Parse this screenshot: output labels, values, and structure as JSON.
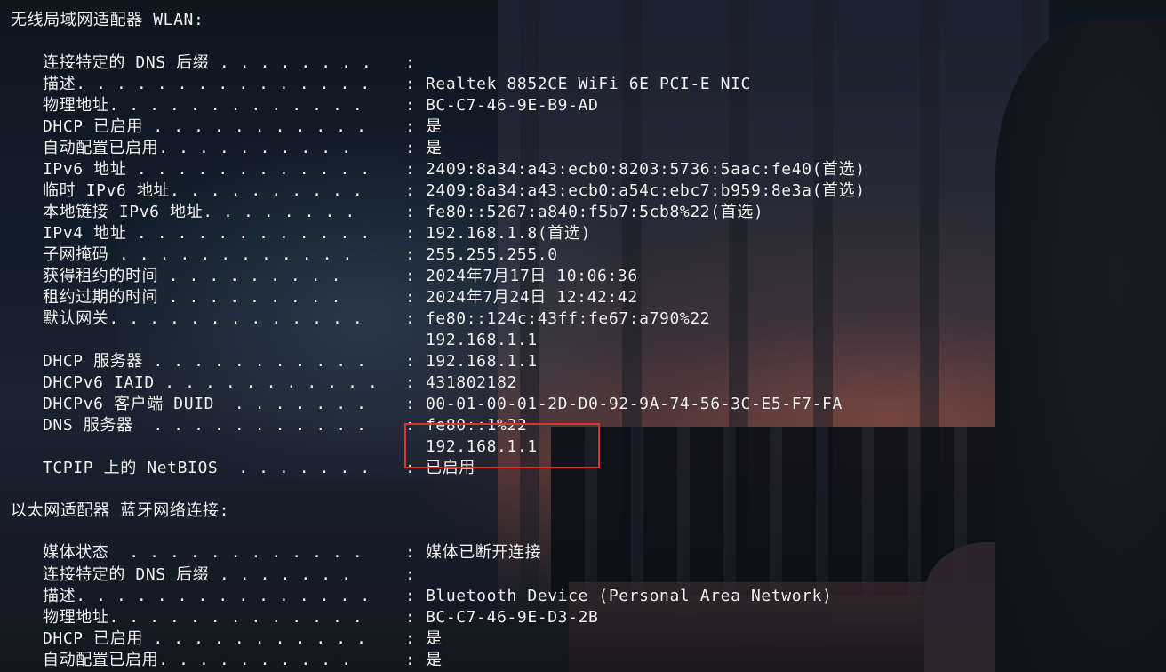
{
  "sections": [
    {
      "title": "无线局域网适配器 WLAN:",
      "entries": [
        {
          "label": "连接特定的 DNS 后缀 . . . . . . . .",
          "value": ""
        },
        {
          "label": "描述. . . . . . . . . . . . . . .",
          "value": "Realtek 8852CE WiFi 6E PCI-E NIC"
        },
        {
          "label": "物理地址. . . . . . . . . . . . .",
          "value": "BC-C7-46-9E-B9-AD"
        },
        {
          "label": "DHCP 已启用 . . . . . . . . . . .",
          "value": "是"
        },
        {
          "label": "自动配置已启用. . . . . . . . . .",
          "value": "是"
        },
        {
          "label": "IPv6 地址 . . . . . . . . . . . .",
          "value": "2409:8a34:a43:ecb0:8203:5736:5aac:fe40(首选)"
        },
        {
          "label": "临时 IPv6 地址. . . . . . . . . .",
          "value": "2409:8a34:a43:ecb0:a54c:ebc7:b959:8e3a(首选)"
        },
        {
          "label": "本地链接 IPv6 地址. . . . . . . .",
          "value": "fe80::5267:a840:f5b7:5cb8%22(首选)"
        },
        {
          "label": "IPv4 地址 . . . . . . . . . . . .",
          "value": "192.168.1.8(首选)"
        },
        {
          "label": "子网掩码 . . . . . . . . . . . .",
          "value": "255.255.255.0"
        },
        {
          "label": "获得租约的时间 . . . . . . . . .",
          "value": "2024年7月17日 10:06:36"
        },
        {
          "label": "租约过期的时间 . . . . . . . . .",
          "value": "2024年7月24日 12:42:42"
        },
        {
          "label": "默认网关. . . . . . . . . . . . .",
          "value": "fe80::124c:43ff:fe67:a790%22"
        },
        {
          "label": "",
          "value": "192.168.1.1"
        },
        {
          "label": "DHCP 服务器 . . . . . . . . . . .",
          "value": "192.168.1.1"
        },
        {
          "label": "DHCPv6 IAID . . . . . . . . . . .",
          "value": "431802182"
        },
        {
          "label": "DHCPv6 客户端 DUID  . . . . . . .",
          "value": "00-01-00-01-2D-D0-92-9A-74-56-3C-E5-F7-FA"
        },
        {
          "label": "DNS 服务器  . . . . . . . . . . .",
          "value": "fe80::1%22"
        },
        {
          "label": "",
          "value": "192.168.1.1"
        },
        {
          "label": "TCPIP 上的 NetBIOS  . . . . . . .",
          "value": "已启用"
        }
      ]
    },
    {
      "title": "以太网适配器 蓝牙网络连接:",
      "entries": [
        {
          "label": "媒体状态  . . . . . . . . . . . .",
          "value": "媒体已断开连接"
        },
        {
          "label": "连接特定的 DNS 后缀 . . . . . . .",
          "value": ""
        },
        {
          "label": "描述. . . . . . . . . . . . . . .",
          "value": "Bluetooth Device (Personal Area Network)"
        },
        {
          "label": "物理地址. . . . . . . . . . . . .",
          "value": "BC-C7-46-9E-D3-2B"
        },
        {
          "label": "DHCP 已启用 . . . . . . . . . . .",
          "value": "是"
        },
        {
          "label": "自动配置已启用. . . . . . . . . .",
          "value": "是"
        }
      ]
    }
  ],
  "colon": ":",
  "highlight_color": "#e0322f"
}
